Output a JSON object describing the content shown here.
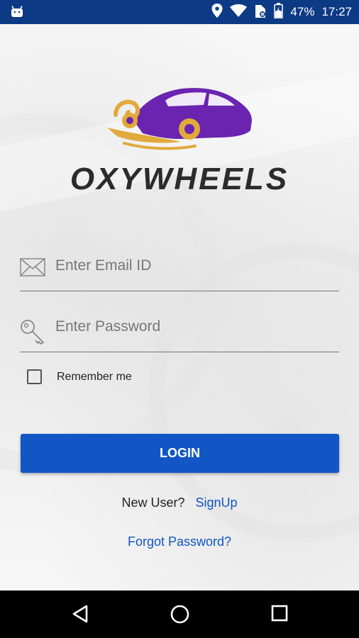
{
  "status_bar": {
    "battery_percent": "47%",
    "time": "17:27",
    "icons": [
      "android-icon",
      "location-icon",
      "wifi-icon",
      "signal-icon",
      "battery-icon"
    ]
  },
  "brand": {
    "name": "OXYWHEELS"
  },
  "form": {
    "email_placeholder": "Enter Email ID",
    "password_placeholder": "Enter Password",
    "remember_label": "Remember me",
    "login_label": "LOGIN",
    "new_user_text": "New User?",
    "signup_label": "SignUp",
    "forgot_label": "Forgot Password?"
  },
  "colors": {
    "status_bar": "#0d3a85",
    "primary": "#1156c4",
    "logo_purple": "#6a24b0",
    "logo_gold": "#e2a93b"
  },
  "nav": {
    "icons": [
      "back-icon",
      "home-icon",
      "recents-icon"
    ]
  }
}
